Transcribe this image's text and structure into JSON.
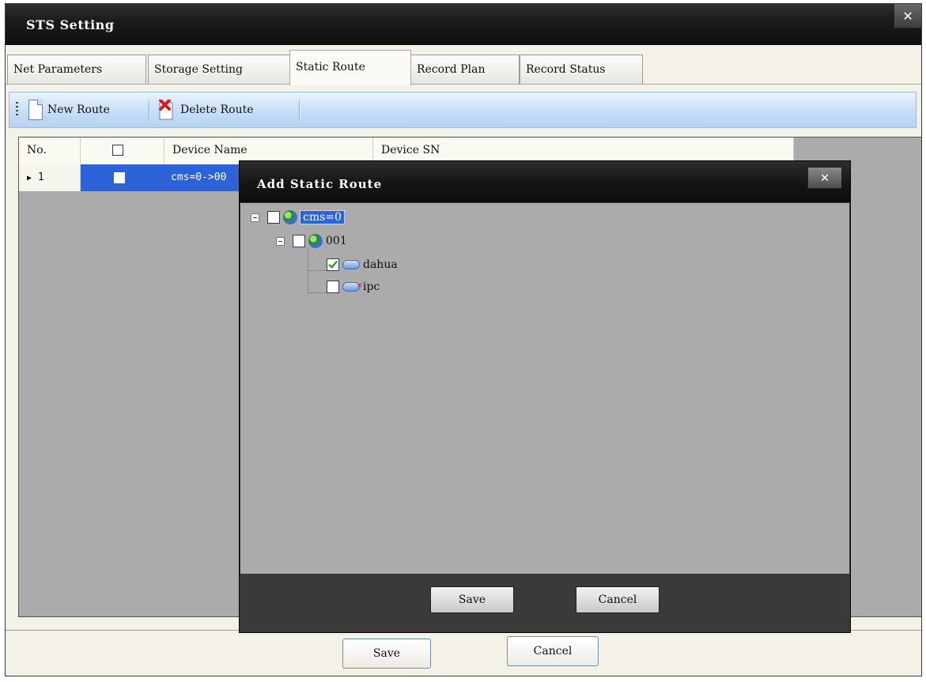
{
  "window": {
    "title": "STS Setting",
    "close_glyph": "✕"
  },
  "tabs": [
    {
      "label": "Net Parameters",
      "active": false
    },
    {
      "label": "Storage Setting",
      "active": false
    },
    {
      "label": "Static Route",
      "active": true
    },
    {
      "label": "Record Plan",
      "active": false
    },
    {
      "label": "Record Status",
      "active": false
    }
  ],
  "toolbar": {
    "new_route_label": "New Route",
    "new_route_icon": "new-document-icon",
    "delete_route_label": "Delete Route",
    "delete_route_icon": "delete-x-icon"
  },
  "grid": {
    "columns": [
      "No.",
      "",
      "Device Name",
      "Device SN"
    ],
    "rows": [
      {
        "no": "1",
        "checked": false,
        "device_name": "cms=0->00",
        "device_sn": "",
        "selected": true
      }
    ],
    "selected_color": "#2c63d8"
  },
  "main_buttons": {
    "save": "Save",
    "cancel": "Cancel"
  },
  "dialog": {
    "title": "Add Static Route",
    "close_glyph": "✕",
    "tree": {
      "label": "cms=0",
      "checked": false,
      "icon": "globe-icon",
      "children": [
        {
          "label": "001",
          "checked": false,
          "icon": "globe-icon",
          "children": [
            {
              "label": "dahua",
              "checked": true,
              "icon": "camera-online-icon"
            },
            {
              "label": "ipc",
              "checked": false,
              "icon": "camera-offline-icon"
            }
          ]
        }
      ]
    },
    "buttons": {
      "save": "Save",
      "cancel": "Cancel"
    }
  }
}
